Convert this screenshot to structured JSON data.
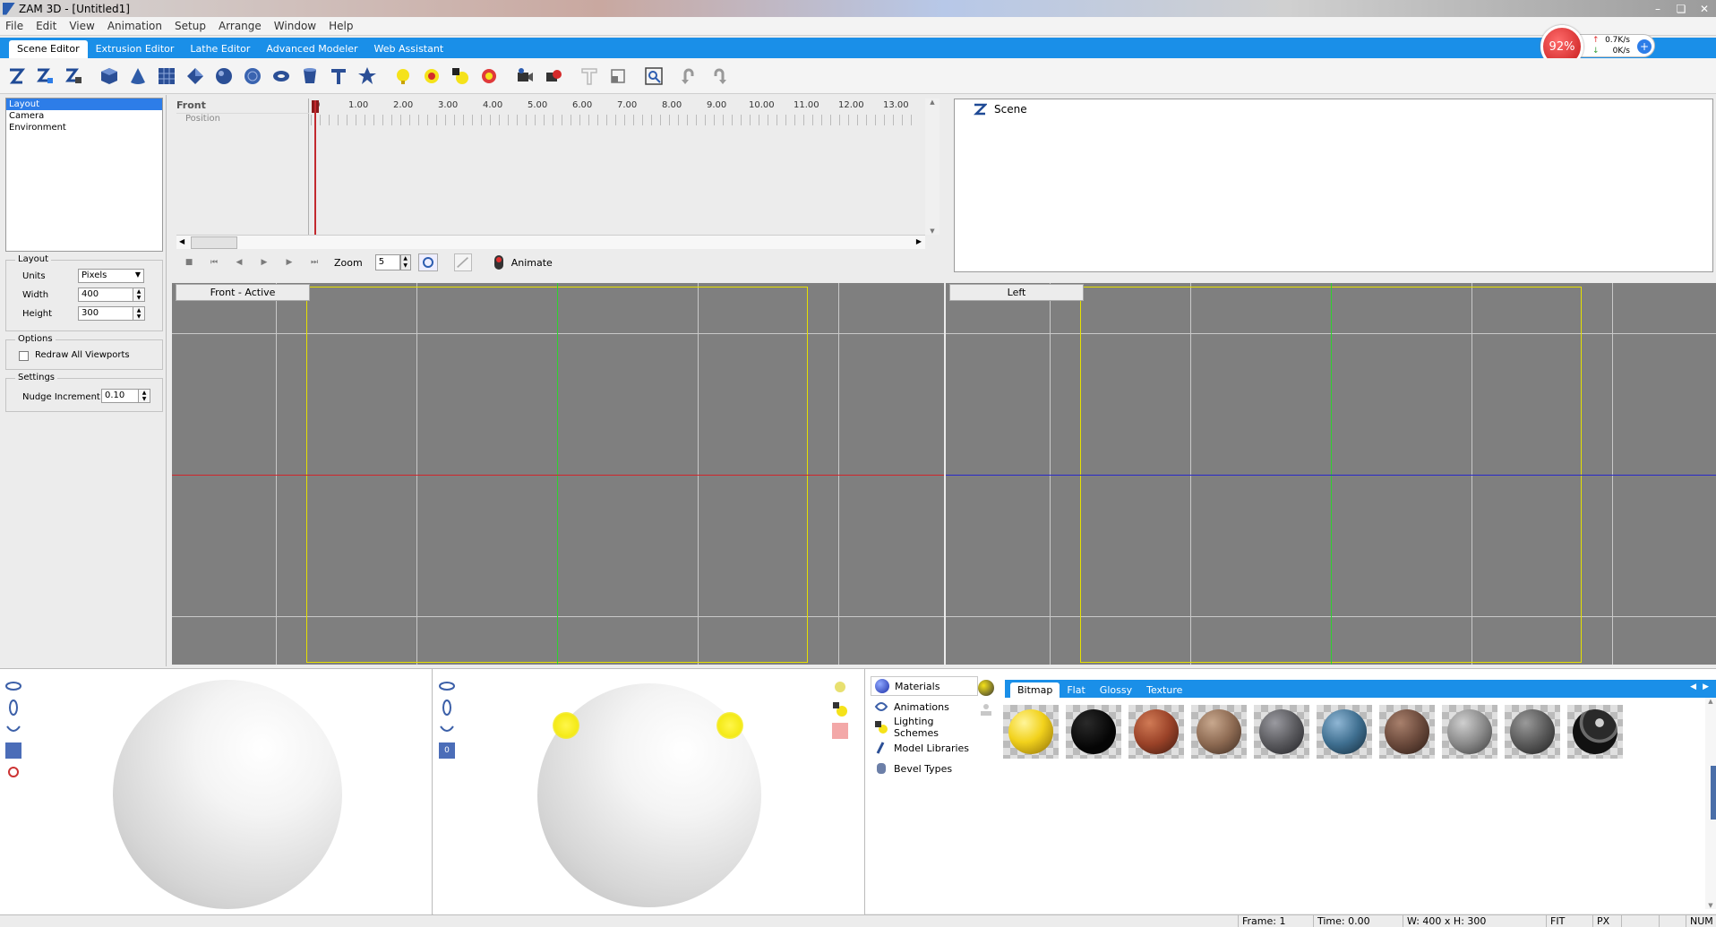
{
  "window": {
    "title": "ZAM 3D - [Untitled1]",
    "controls": [
      "–",
      "❏",
      "✕"
    ]
  },
  "menu": [
    "File",
    "Edit",
    "View",
    "Animation",
    "Setup",
    "Arrange",
    "Window",
    "Help"
  ],
  "editor_tabs": [
    {
      "label": "Scene Editor",
      "active": true
    },
    {
      "label": "Extrusion Editor",
      "active": false
    },
    {
      "label": "Lathe Editor",
      "active": false
    },
    {
      "label": "Advanced Modeler",
      "active": false
    },
    {
      "label": "Web Assistant",
      "active": false
    }
  ],
  "net_meter": {
    "percent": "92%",
    "up": "0.7K/s",
    "down": "0K/s",
    "up_arrow": "↑",
    "down_arrow": "↓",
    "plus": "+"
  },
  "left": {
    "nav": [
      "Layout",
      "Camera",
      "Environment"
    ],
    "layout_group": {
      "legend": "Layout",
      "units_label": "Units",
      "units_value": "Pixels",
      "width_label": "Width",
      "width_value": "400",
      "height_label": "Height",
      "height_value": "300"
    },
    "options_group": {
      "legend": "Options",
      "redraw_label": "Redraw All Viewports"
    },
    "settings_group": {
      "legend": "Settings",
      "nudge_label": "Nudge Increment",
      "nudge_value": "0.10"
    }
  },
  "timeline": {
    "view_name": "Front",
    "track": "Position",
    "ruler": [
      "0",
      "1.00",
      "2.00",
      "3.00",
      "4.00",
      "5.00",
      "6.00",
      "7.00",
      "8.00",
      "9.00",
      "10.00",
      "11.00",
      "12.00",
      "13.00"
    ],
    "zoom_label": "Zoom",
    "zoom_value": "5",
    "animate_label": "Animate",
    "controls": [
      "■",
      "⏮",
      "◀",
      "▶",
      "▶",
      "⏭"
    ]
  },
  "scene_tree": {
    "root": "Scene"
  },
  "viewports": [
    {
      "label": "Front - Active",
      "axis_color": "#d0262c"
    },
    {
      "label": "Left",
      "axis_color": "#2a2ac8"
    }
  ],
  "lighting_button": "0",
  "library": {
    "nav": [
      "Materials",
      "Animations",
      "Lighting Schemes",
      "Model Libraries",
      "Bevel Types"
    ],
    "tabs": [
      "Bitmap",
      "Flat",
      "Glossy",
      "Texture"
    ],
    "materials": [
      {
        "name": "gold",
        "color": "#f2d21c"
      },
      {
        "name": "black",
        "color": "#050505"
      },
      {
        "name": "rust-brick",
        "color": "#9a4228"
      },
      {
        "name": "tan-stone",
        "color": "#8d6a52"
      },
      {
        "name": "gray-granite",
        "color": "#5a5a5e"
      },
      {
        "name": "blue-marble",
        "color": "#3f6f90"
      },
      {
        "name": "dark-wood",
        "color": "#6b4a3c"
      },
      {
        "name": "gray-metal",
        "color": "#8a8a8a"
      },
      {
        "name": "dark-gray",
        "color": "#5a5a5a"
      },
      {
        "name": "black-camo",
        "color": "#2a2a2a"
      }
    ]
  },
  "status": {
    "frame": "Frame: 1",
    "time": "Time: 0.00",
    "size": "W: 400 x H: 300",
    "fit": "FIT",
    "px": "PX",
    "num": "NUM"
  },
  "colors": {
    "accent": "#1a8fe8",
    "viewport_bg": "#7f7f7f",
    "stage_border": "#e6e000",
    "grid": "#c9c9c9"
  }
}
